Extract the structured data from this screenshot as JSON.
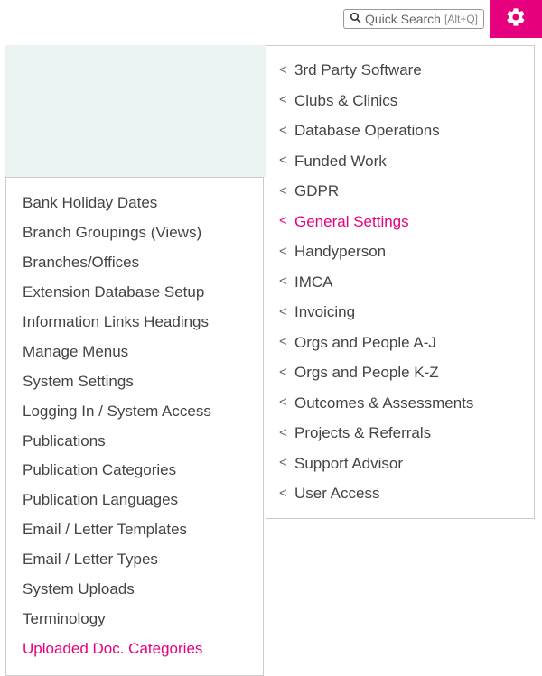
{
  "search": {
    "placeholder": "Quick Search",
    "shortcut": "[Alt+Q]"
  },
  "categories": [
    {
      "label": "3rd Party Software",
      "active": false
    },
    {
      "label": "Clubs & Clinics",
      "active": false
    },
    {
      "label": "Database Operations",
      "active": false
    },
    {
      "label": "Funded Work",
      "active": false
    },
    {
      "label": "GDPR",
      "active": false
    },
    {
      "label": "General Settings",
      "active": true
    },
    {
      "label": "Handyperson",
      "active": false
    },
    {
      "label": "IMCA",
      "active": false
    },
    {
      "label": "Invoicing",
      "active": false
    },
    {
      "label": "Orgs and People A-J",
      "active": false
    },
    {
      "label": "Orgs and People K-Z",
      "active": false
    },
    {
      "label": "Outcomes & Assessments",
      "active": false
    },
    {
      "label": "Projects & Referrals",
      "active": false
    },
    {
      "label": "Support Advisor",
      "active": false
    },
    {
      "label": "User Access",
      "active": false
    }
  ],
  "submenu": [
    {
      "label": "Bank Holiday Dates",
      "active": false
    },
    {
      "label": "Branch Groupings (Views)",
      "active": false
    },
    {
      "label": "Branches/Offices",
      "active": false
    },
    {
      "label": "Extension Database Setup",
      "active": false
    },
    {
      "label": "Information Links Headings",
      "active": false
    },
    {
      "label": "Manage Menus",
      "active": false
    },
    {
      "label": "System Settings",
      "active": false
    },
    {
      "label": "Logging In / System Access",
      "active": false
    },
    {
      "label": "Publications",
      "active": false
    },
    {
      "label": "Publication Categories",
      "active": false
    },
    {
      "label": "Publication Languages",
      "active": false
    },
    {
      "label": "Email / Letter Templates",
      "active": false
    },
    {
      "label": "Email / Letter Types",
      "active": false
    },
    {
      "label": "System Uploads",
      "active": false
    },
    {
      "label": "Terminology",
      "active": false
    },
    {
      "label": "Uploaded Doc. Categories",
      "active": true
    }
  ]
}
